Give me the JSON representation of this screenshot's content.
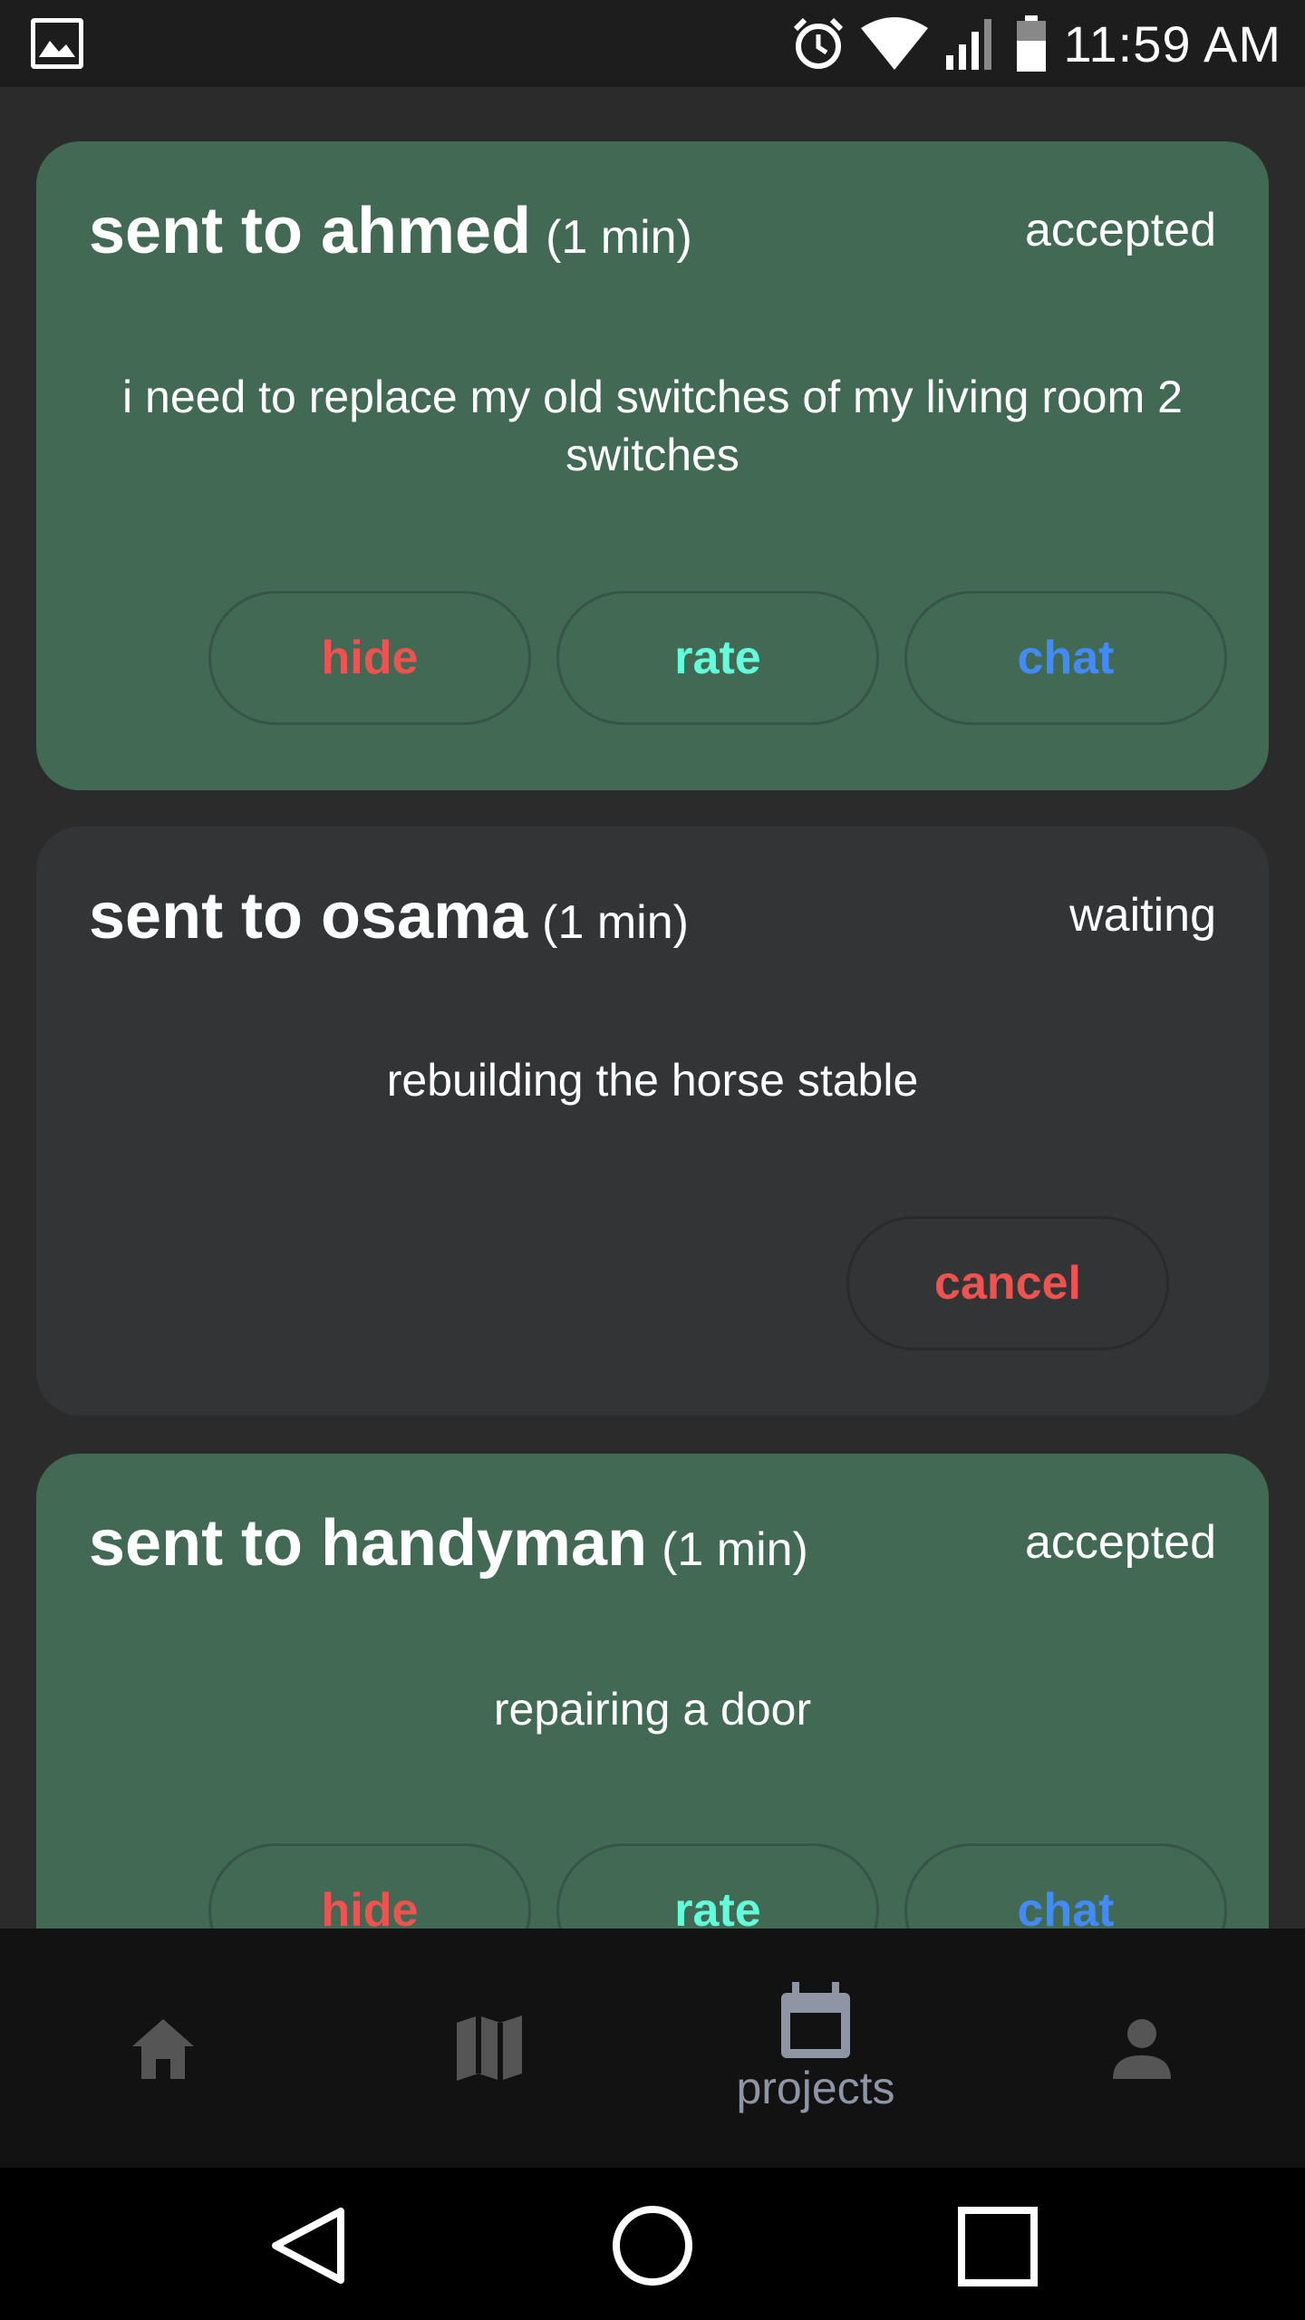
{
  "status_bar": {
    "time": "11:59 AM",
    "icons": [
      "gallery-icon",
      "alarm-icon",
      "wifi-icon",
      "signal-icon",
      "battery-icon"
    ]
  },
  "requests": [
    {
      "name": "sent to ahmed",
      "duration": "(1 min)",
      "status": "accepted",
      "description": "i need to replace my old switches of my living room 2 switches",
      "actions": [
        "hide",
        "rate",
        "chat"
      ]
    },
    {
      "name": "sent to osama",
      "duration": "(1 min)",
      "status": "waiting",
      "description": "rebuilding the horse stable",
      "actions": [
        "cancel"
      ]
    },
    {
      "name": "sent to handyman",
      "duration": "(1 min)",
      "status": "accepted",
      "description": "repairing a door",
      "actions": [
        "hide",
        "rate",
        "chat"
      ]
    }
  ],
  "bottom_nav": {
    "items": [
      {
        "icon": "home-icon",
        "label": ""
      },
      {
        "icon": "map-icon",
        "label": ""
      },
      {
        "icon": "calendar-icon",
        "label": "projects"
      },
      {
        "icon": "person-icon",
        "label": ""
      }
    ],
    "active_index": 2
  },
  "colors": {
    "accepted_card": "#416954",
    "waiting_card": "#323436",
    "hide": "#ef5350",
    "rate": "#64ffda",
    "chat": "#448aff",
    "nav_active": "#8e95a5"
  }
}
